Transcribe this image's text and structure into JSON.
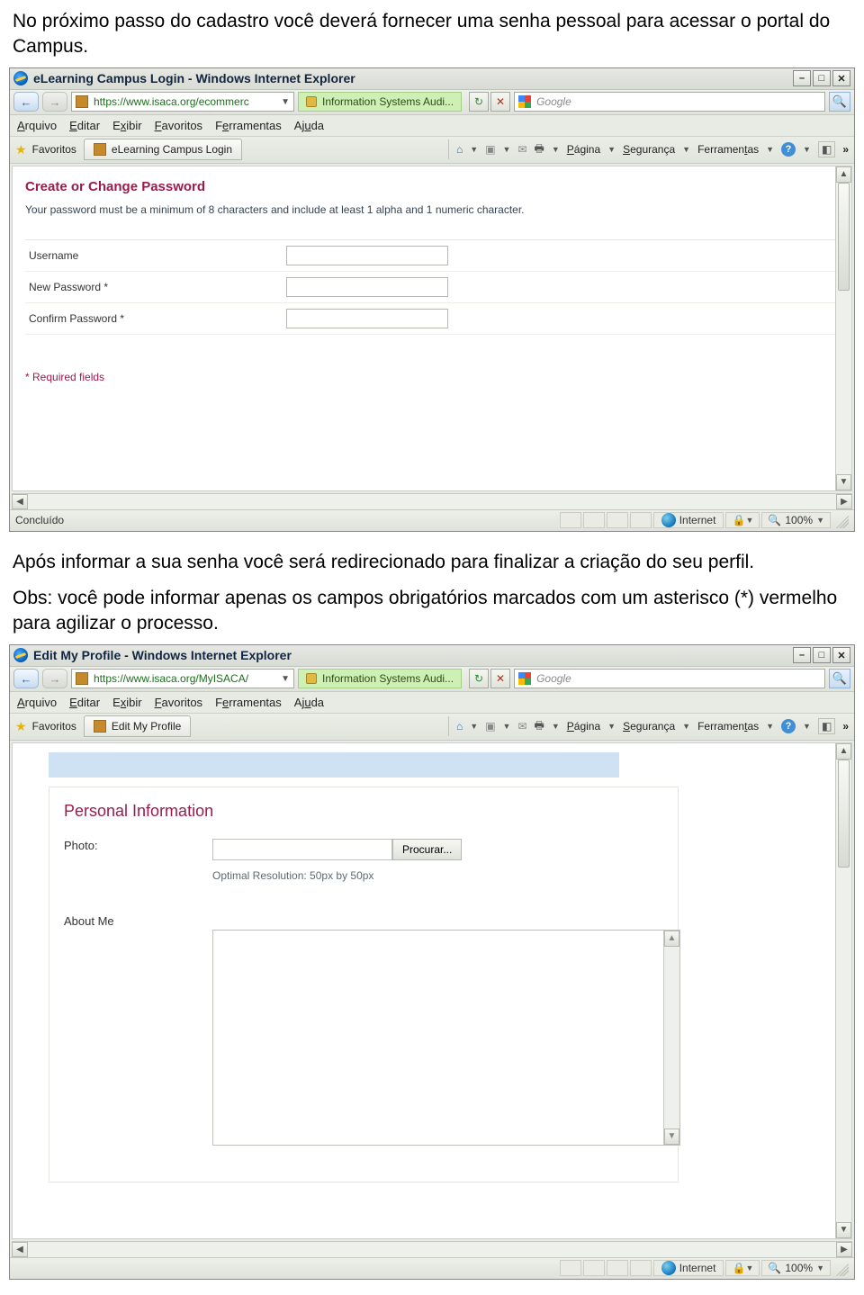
{
  "doc": {
    "para1": "No próximo passo do cadastro você deverá fornecer uma senha pessoal para acessar o portal do Campus.",
    "para2": "Após informar a sua senha você será redirecionado para finalizar a criação do seu perfil.",
    "para3": "Obs: você pode informar apenas os campos obrigatórios marcados com um asterisco (*) vermelho para agilizar o processo."
  },
  "win1": {
    "title": "eLearning Campus Login - Windows Internet Explorer",
    "url": "https://www.isaca.org/ecommerc",
    "siteBadge": "Information Systems Audi...",
    "searchPlaceholder": "Google",
    "menu": {
      "arquivo": "Arquivo",
      "editar": "Editar",
      "exibir": "Exibir",
      "favoritos": "Favoritos",
      "ferramentas": "Ferramentas",
      "ajuda": "Ajuda"
    },
    "favLabel": "Favoritos",
    "tabLabel": "eLearning Campus Login",
    "tools": {
      "pagina": "Página",
      "seguranca": "Segurança",
      "ferramentas": "Ferramentas"
    },
    "page": {
      "heading": "Create or Change Password",
      "desc": "Your password must be a minimum of 8 characters and include at least 1 alpha and 1 numeric character.",
      "fields": {
        "username": "Username",
        "newpass": "New Password *",
        "confirm": "Confirm Password *"
      },
      "required": "* Required fields"
    },
    "status": {
      "done": "Concluído",
      "zone": "Internet",
      "zoom": "100%"
    }
  },
  "win2": {
    "title": "Edit My Profile - Windows Internet Explorer",
    "url": "https://www.isaca.org/MyISACA/",
    "siteBadge": "Information Systems Audi...",
    "searchPlaceholder": "Google",
    "menu": {
      "arquivo": "Arquivo",
      "editar": "Editar",
      "exibir": "Exibir",
      "favoritos": "Favoritos",
      "ferramentas": "Ferramentas",
      "ajuda": "Ajuda"
    },
    "favLabel": "Favoritos",
    "tabLabel": "Edit My Profile",
    "tools": {
      "pagina": "Página",
      "seguranca": "Segurança",
      "ferramentas": "Ferramentas"
    },
    "page": {
      "heading": "Personal Information",
      "photoLabel": "Photo:",
      "browse": "Procurar...",
      "optRes": "Optimal Resolution: 50px by 50px",
      "aboutLabel": "About Me"
    },
    "status": {
      "zone": "Internet",
      "zoom": "100%"
    }
  }
}
